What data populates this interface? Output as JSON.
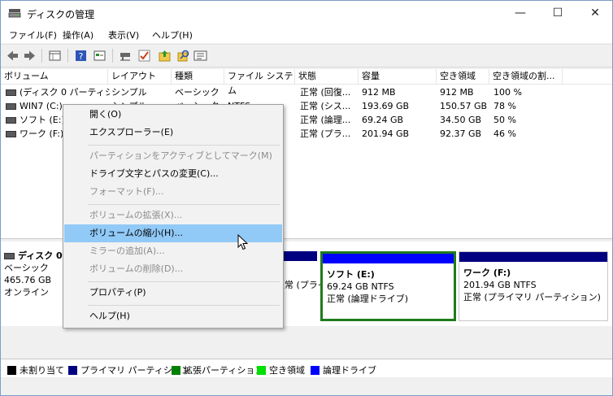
{
  "window": {
    "title": "ディスクの管理",
    "controls": {
      "minimize": "—",
      "maximize": "☐",
      "close": "✕"
    }
  },
  "menu": [
    "ファイル(F)",
    "操作(A)",
    "表示(V)",
    "ヘルプ(H)"
  ],
  "toolbar_icons": [
    "back-icon",
    "forward-icon",
    "list-view-icon",
    "help-icon",
    "properties-icon",
    "connect-icon",
    "check-icon",
    "folder-up-icon",
    "search-icon",
    "settings-list-icon"
  ],
  "table": {
    "columns": [
      "ボリューム",
      "レイアウト",
      "種類",
      "ファイル システム",
      "状態",
      "容量",
      "空き領域",
      "空き領域の割..."
    ],
    "rows": [
      [
        "(ディスク 0 パーティシ...",
        "シンプル",
        "ベーシック",
        "",
        "正常 (回復...",
        "912 MB",
        "912 MB",
        "100 %"
      ],
      [
        "WIN7 (C:)",
        "シンプル",
        "ベーシック",
        "NTFS",
        "正常 (シス...",
        "193.69 GB",
        "150.57 GB",
        "78 %"
      ],
      [
        "ソフト (E:)",
        "",
        "",
        "",
        "正常 (論理...",
        "69.24 GB",
        "34.50 GB",
        "50 %"
      ],
      [
        "ワーク (F:)",
        "",
        "",
        "",
        "正常 (プラ...",
        "201.94 GB",
        "92.37 GB",
        "46 %"
      ]
    ]
  },
  "disk": {
    "name": "ディスク 0",
    "type": "ベーシック",
    "size": "465.76 GB",
    "status": "オンライン",
    "partial_partition_text": "正常 (プライマリ パーティ",
    "partitions": [
      {
        "name": "ソフト (E:)",
        "size": "69.24 GB NTFS",
        "status": "正常 (論理ドライブ)"
      },
      {
        "name": "ワーク (F:)",
        "size": "201.94 GB NTFS",
        "status": "正常 (プライマリ パーティション)"
      }
    ]
  },
  "legend": [
    {
      "label": "未割り当て",
      "color": "#000000"
    },
    {
      "label": "プライマリ パーティション",
      "color": "#000080"
    },
    {
      "label": "拡張パーティション",
      "color": "#008000"
    },
    {
      "label": "空き領域",
      "color": "#00e000"
    },
    {
      "label": "論理ドライブ",
      "color": "#0000ff"
    }
  ],
  "context_menu": {
    "open": "開く(O)",
    "explore": "エクスプローラー(E)",
    "mark_active": "パーティションをアクティブとしてマーク(M)",
    "change_letter": "ドライブ文字とパスの変更(C)...",
    "format": "フォーマット(F)...",
    "extend": "ボリュームの拡張(X)...",
    "shrink": "ボリュームの縮小(H)...",
    "add_mirror": "ミラーの追加(A)...",
    "delete": "ボリュームの削除(D)...",
    "properties": "プロパティ(P)",
    "help": "ヘルプ(H)"
  },
  "colors": {
    "logical_bar": "#0000ff",
    "primary_bar": "#000080",
    "selection_border": "#1e7b1e",
    "menu_highlight": "#91c9f7"
  }
}
